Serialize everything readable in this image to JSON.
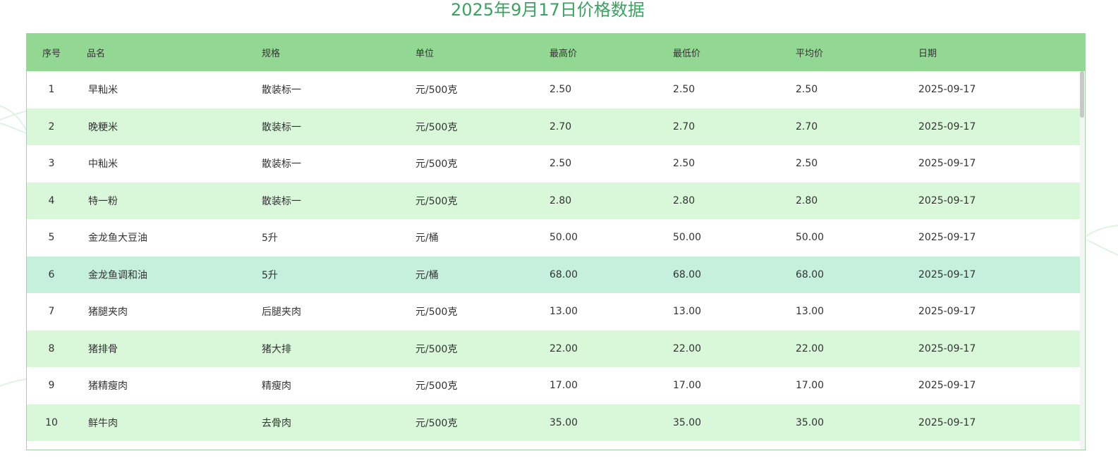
{
  "title": "2025年9月17日价格数据",
  "table": {
    "headers": {
      "idx": "序号",
      "name": "品名",
      "spec": "规格",
      "unit": "单位",
      "max": "最高价",
      "min": "最低价",
      "avg": "平均价",
      "date": "日期"
    },
    "rows": [
      {
        "idx": "1",
        "name": "早籼米",
        "spec": "散装标一",
        "unit": "元/500克",
        "max": "2.50",
        "min": "2.50",
        "avg": "2.50",
        "date": "2025-09-17"
      },
      {
        "idx": "2",
        "name": "晚粳米",
        "spec": "散装标一",
        "unit": "元/500克",
        "max": "2.70",
        "min": "2.70",
        "avg": "2.70",
        "date": "2025-09-17"
      },
      {
        "idx": "3",
        "name": "中籼米",
        "spec": "散装标一",
        "unit": "元/500克",
        "max": "2.50",
        "min": "2.50",
        "avg": "2.50",
        "date": "2025-09-17"
      },
      {
        "idx": "4",
        "name": "特一粉",
        "spec": "散装标一",
        "unit": "元/500克",
        "max": "2.80",
        "min": "2.80",
        "avg": "2.80",
        "date": "2025-09-17"
      },
      {
        "idx": "5",
        "name": "金龙鱼大豆油",
        "spec": "5升",
        "unit": "元/桶",
        "max": "50.00",
        "min": "50.00",
        "avg": "50.00",
        "date": "2025-09-17"
      },
      {
        "idx": "6",
        "name": "金龙鱼调和油",
        "spec": "5升",
        "unit": "元/桶",
        "max": "68.00",
        "min": "68.00",
        "avg": "68.00",
        "date": "2025-09-17"
      },
      {
        "idx": "7",
        "name": "猪腿夹肉",
        "spec": "后腿夹肉",
        "unit": "元/500克",
        "max": "13.00",
        "min": "13.00",
        "avg": "13.00",
        "date": "2025-09-17"
      },
      {
        "idx": "8",
        "name": "猪排骨",
        "spec": "猪大排",
        "unit": "元/500克",
        "max": "22.00",
        "min": "22.00",
        "avg": "22.00",
        "date": "2025-09-17"
      },
      {
        "idx": "9",
        "name": "猪精瘦肉",
        "spec": "精瘦肉",
        "unit": "元/500克",
        "max": "17.00",
        "min": "17.00",
        "avg": "17.00",
        "date": "2025-09-17"
      },
      {
        "idx": "10",
        "name": "鲜牛肉",
        "spec": "去骨肉",
        "unit": "元/500克",
        "max": "35.00",
        "min": "35.00",
        "avg": "35.00",
        "date": "2025-09-17"
      }
    ],
    "hovered_row": 5
  },
  "colors": {
    "title": "#3aa35f",
    "header_bg": "#92d893",
    "stripe_bg": "#d9f8da",
    "hover_bg": "#c5f0dc",
    "border": "#9fd3a5"
  }
}
